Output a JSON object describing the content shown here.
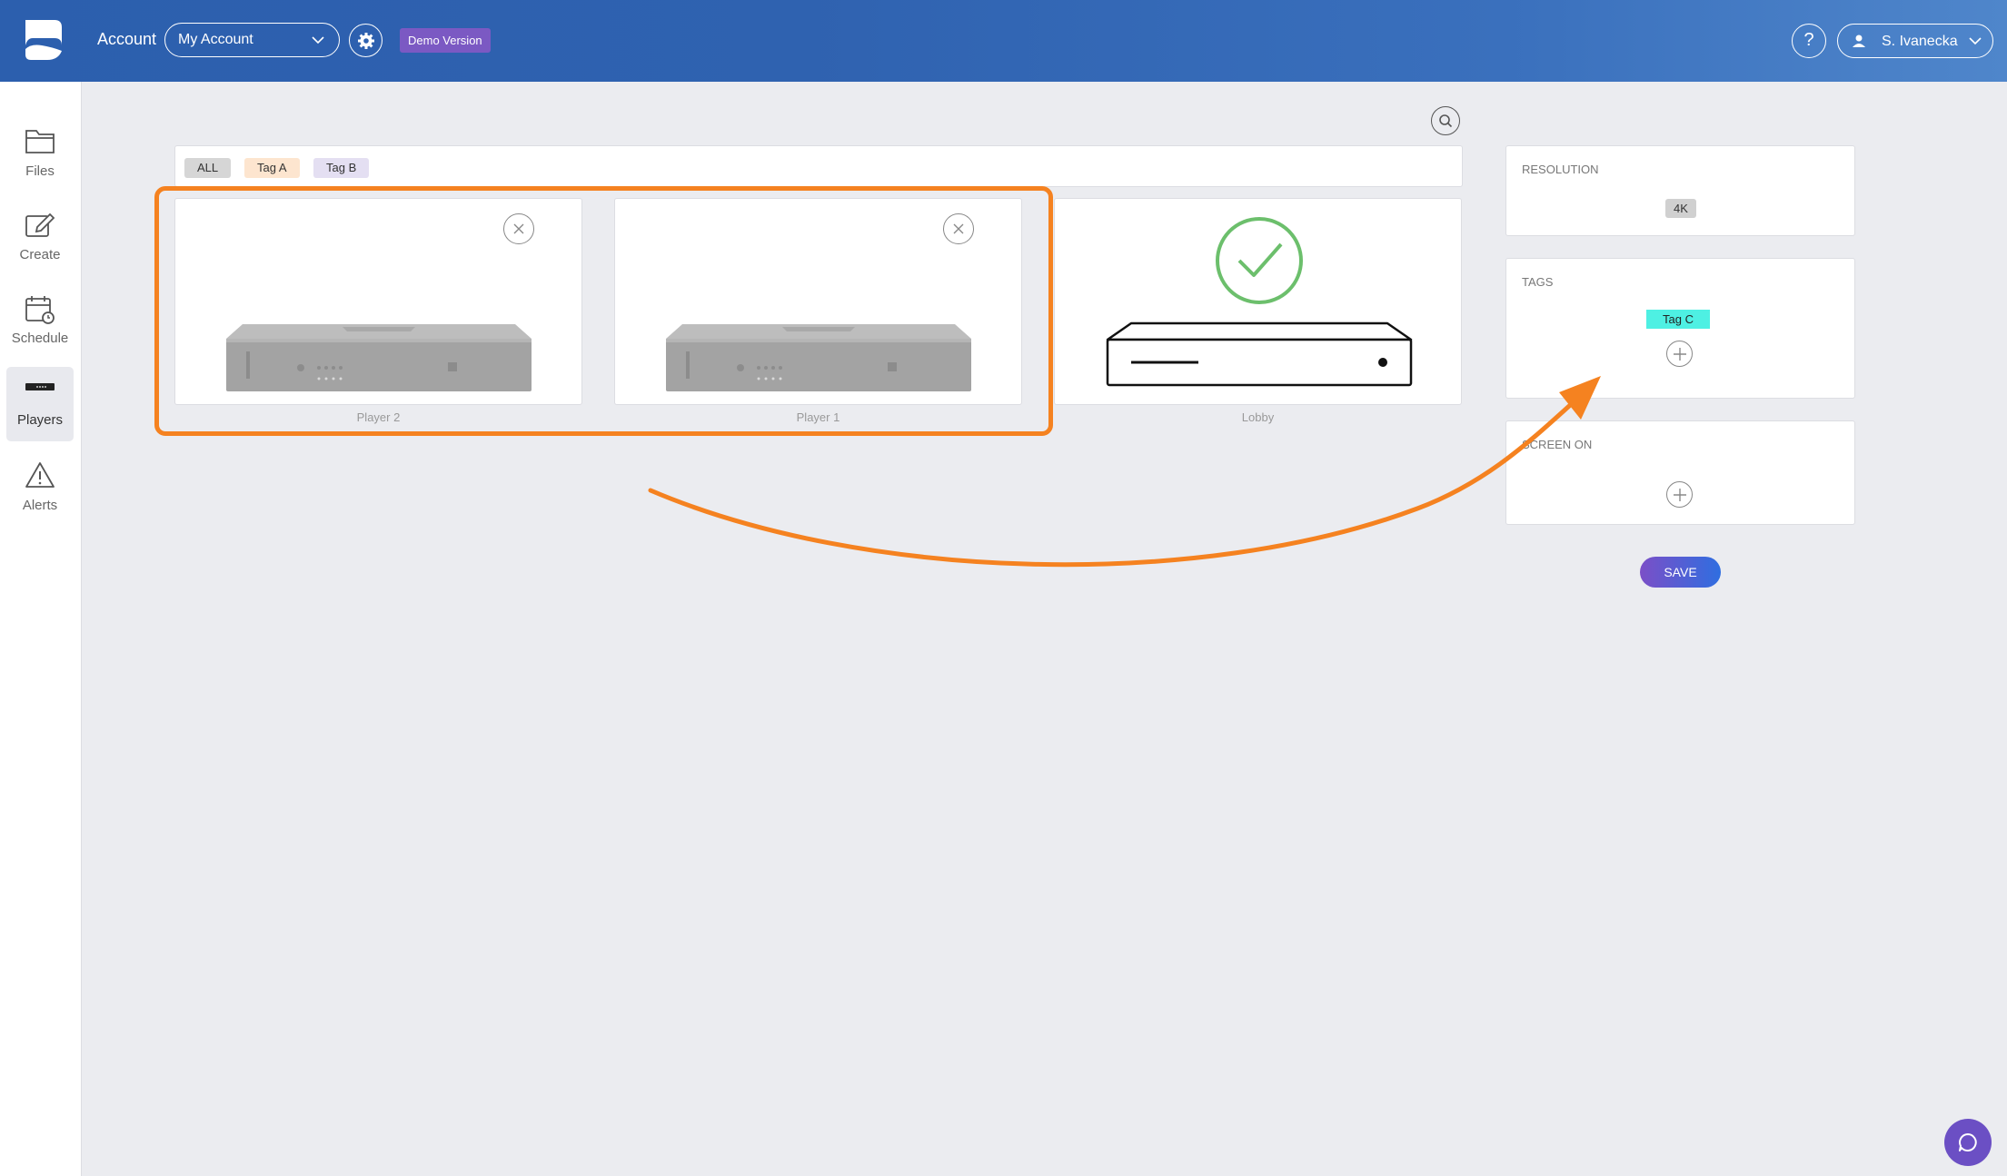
{
  "header": {
    "account_label": "Account",
    "account_select": "My Account",
    "demo_badge": "Demo Version",
    "help": "?",
    "user_name": "S. Ivanecka"
  },
  "sidebar": {
    "items": [
      {
        "label": "Files",
        "icon": "folder-icon"
      },
      {
        "label": "Create",
        "icon": "edit-icon"
      },
      {
        "label": "Schedule",
        "icon": "calendar-icon"
      },
      {
        "label": "Players",
        "icon": "player-icon",
        "active": true
      },
      {
        "label": "Alerts",
        "icon": "alert-icon"
      }
    ]
  },
  "filters": {
    "tags": [
      {
        "label": "ALL",
        "color": "#d6d6d6"
      },
      {
        "label": "Tag A",
        "color": "#fde5cf"
      },
      {
        "label": "Tag B",
        "color": "#e4dff2"
      }
    ]
  },
  "players": [
    {
      "name": "Player 2",
      "state": "deselectable"
    },
    {
      "name": "Player 1",
      "state": "deselectable"
    },
    {
      "name": "Lobby",
      "state": "selected"
    }
  ],
  "panel": {
    "resolution_title": "RESOLUTION",
    "resolution_value": "4K",
    "tags_title": "TAGS",
    "tag_value": "Tag C",
    "screen_title": "SCREEN ON",
    "save_label": "SAVE"
  },
  "colors": {
    "highlight": "#f58220",
    "accent": "#7b59c3",
    "tag_c": "#4ef0e3",
    "check": "#6cbf6c"
  }
}
